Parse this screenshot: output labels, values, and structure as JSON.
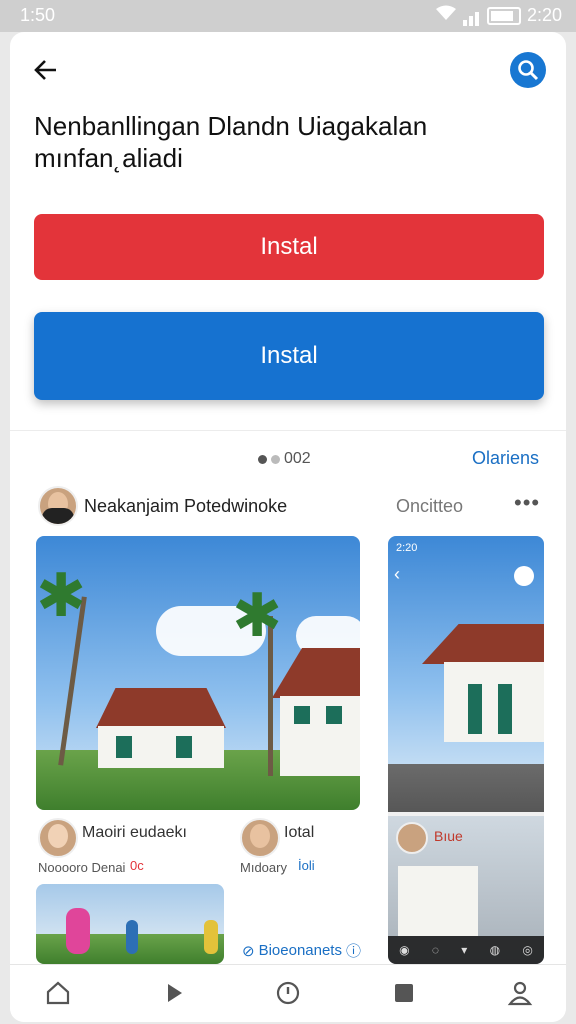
{
  "status": {
    "time": "1:50",
    "right_time": "2:20"
  },
  "header": {
    "title": "Nenbanllingan Dlandn Uiagakalan\nmınfan˛aliadi"
  },
  "buttons": {
    "primary": "Instal",
    "secondary": "Instal"
  },
  "carousel": {
    "indicator": "002",
    "see_all": "Olariens"
  },
  "post": {
    "author": "Neakanjaim Potedwinoke",
    "follow": "Oncitteo",
    "more": "•••"
  },
  "grid": [
    {
      "name": "Maoiri eudaekı",
      "meta": "Nooooro Denai",
      "badge": "0c"
    },
    {
      "name": "Iotal",
      "meta": "Mıdoary",
      "badge": "İoli"
    },
    {
      "name": "Bıue",
      "meta": ""
    }
  ],
  "footer": {
    "link": "Bioeonanets"
  },
  "phone_overlay": {
    "time": "2:20"
  },
  "colors": {
    "accent_red": "#e3343a",
    "accent_blue": "#1672d0",
    "link": "#1a6fc4"
  },
  "icons": [
    "back-arrow-icon",
    "search-icon",
    "home-icon",
    "play-icon",
    "clock-icon",
    "square-icon",
    "profile-icon",
    "more-icon",
    "play-icon-small"
  ]
}
